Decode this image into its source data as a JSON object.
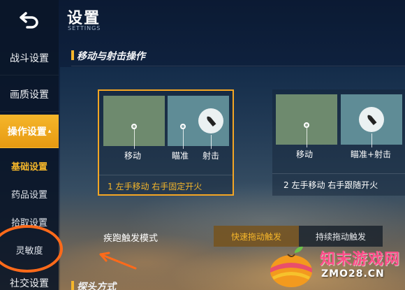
{
  "header": {
    "title": "设置",
    "subtitle": "SETTINGS"
  },
  "sidebar": {
    "items": [
      {
        "label": "战斗设置"
      },
      {
        "label": "画质设置"
      },
      {
        "label": "操作设置",
        "caret": "▴"
      }
    ],
    "subitems": [
      {
        "label": "基础设置"
      },
      {
        "label": "药品设置"
      },
      {
        "label": "拾取设置"
      },
      {
        "label": "灵敏度"
      }
    ],
    "bottom_item": {
      "label": "社交设置"
    }
  },
  "section": {
    "title": "移动与射击操作"
  },
  "options": [
    {
      "move_label": "移动",
      "aim_label": "瞄准",
      "fire_label": "射击",
      "caption": "1  左手移动  右手固定开火",
      "selected": true
    },
    {
      "move_label": "移动",
      "aimfire_label": "瞄准+射击",
      "caption": "2  左手移动  右手跟随开火",
      "selected": false
    }
  ],
  "sprint": {
    "label": "疾跑触发模式",
    "options": [
      "快速拖动触发",
      "持续拖动触发"
    ],
    "selected": "快速拖动触发"
  },
  "section2": {
    "title": "探头方式"
  },
  "watermark": {
    "text": "知末游戏网",
    "domain": "ZMO28.CN"
  },
  "colors": {
    "accent": "#f5b62a",
    "highlight": "#ff6a1a"
  }
}
